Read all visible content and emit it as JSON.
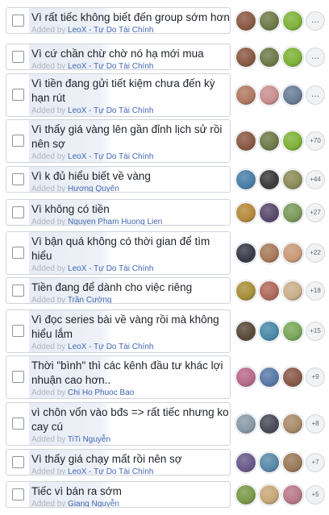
{
  "poll": {
    "options": [
      {
        "lines": [
          "Vì rất tiếc không biết đến group sớm hơn"
        ],
        "added_by_prefix": "Added by",
        "author": "LeoX - Tự Do Tài Chính",
        "more": "...",
        "avatars": [
          "#8a5a44",
          "#6f7b4a",
          "#7fb23a"
        ]
      },
      {
        "lines": [
          "Vì cứ chần chừ chờ nó hạ mới mua"
        ],
        "added_by_prefix": "Added by",
        "author": "LeoX - Tự Do Tài Chính",
        "more": "...",
        "avatars": [
          "#8a5a44",
          "#6f7b4a",
          "#7fb23a"
        ]
      },
      {
        "lines": [
          "Vì tiền đang gửi tiết kiệm chưa đến kỳ",
          "hạn rút"
        ],
        "added_by_prefix": "Added by",
        "author": "LeoX - Tự Do Tài Chính",
        "more": "...",
        "avatars": [
          "#b07a62",
          "#c98f8f",
          "#6a7e98"
        ]
      },
      {
        "lines": [
          "Vì thấy giá vàng lên gần đỉnh lịch sử rồi",
          "nên sợ"
        ],
        "added_by_prefix": "Added by",
        "author": "LeoX - Tự Do Tài Chính",
        "more": "+70",
        "avatars": [
          "#8a5a44",
          "#6f7b4a",
          "#7fb23a"
        ]
      },
      {
        "lines": [
          "Vì k đủ hiểu biết về vàng"
        ],
        "added_by_prefix": "Added by",
        "author": "Hương Quyên",
        "more": "+44",
        "avatars": [
          "#4a7fa8",
          "#3c3c3c",
          "#8c8c5a"
        ]
      },
      {
        "lines": [
          "Vì không có tiền"
        ],
        "added_by_prefix": "Added by",
        "author": "Nguyen Pham Huong Lien",
        "more": "+27",
        "avatars": [
          "#b58a3c",
          "#5a4a6e",
          "#7a9a5a"
        ]
      },
      {
        "lines": [
          "Vì bận quá không có thời gian để tìm",
          "hiểu"
        ],
        "added_by_prefix": "Added by",
        "author": "LeoX - Tự Do Tài Chính",
        "more": "+22",
        "avatars": [
          "#3a3a4a",
          "#a87a5a",
          "#c99a7a"
        ]
      },
      {
        "lines": [
          "Tiền đang để dành cho việc riêng"
        ],
        "added_by_prefix": "Added by",
        "author": "Trần Cường",
        "more": "+18",
        "avatars": [
          "#a8903a",
          "#b06a5a",
          "#c9b08a"
        ]
      },
      {
        "lines": [
          "Vì đọc series bài về vàng rồi mà không",
          "hiểu lắm"
        ],
        "added_by_prefix": "Added by",
        "author": "LeoX - Tự Do Tài Chính",
        "more": "+15",
        "avatars": [
          "#5a4a3a",
          "#4a8aa8",
          "#7aa85a"
        ]
      },
      {
        "lines": [
          "Thời \"bình\" thì các kênh đầu tư khác lợi",
          "nhuận cao hơn.."
        ],
        "added_by_prefix": "Added by",
        "author": "Chi Ho Phuoc Bao",
        "more": "+9",
        "avatars": [
          "#b86a8a",
          "#5a7aa8",
          "#8a5a4a"
        ]
      },
      {
        "lines": [
          "vì chôn vốn vào bđs => rất tiếc nhưng ko",
          "cay cú"
        ],
        "added_by_prefix": "Added by",
        "author": "TiTi Nguyễn",
        "more": "+8",
        "avatars": [
          "#8a9aa8",
          "#4a4a5a",
          "#a88a6a"
        ]
      },
      {
        "lines": [
          "Vì thấy giá chạy mất rồi nên sợ"
        ],
        "added_by_prefix": "Added by",
        "author": "LeoX - Tự Do Tài Chính",
        "more": "+7",
        "avatars": [
          "#6a5a8a",
          "#5a8aa8",
          "#9a7a5a"
        ]
      },
      {
        "lines": [
          "Tiếc vì bán ra sớm"
        ],
        "added_by_prefix": "Added by",
        "author": "Giang Nguyễn",
        "more": "+5",
        "avatars": [
          "#7a9a4a",
          "#c8a87a",
          "#b87a8a"
        ]
      }
    ]
  }
}
